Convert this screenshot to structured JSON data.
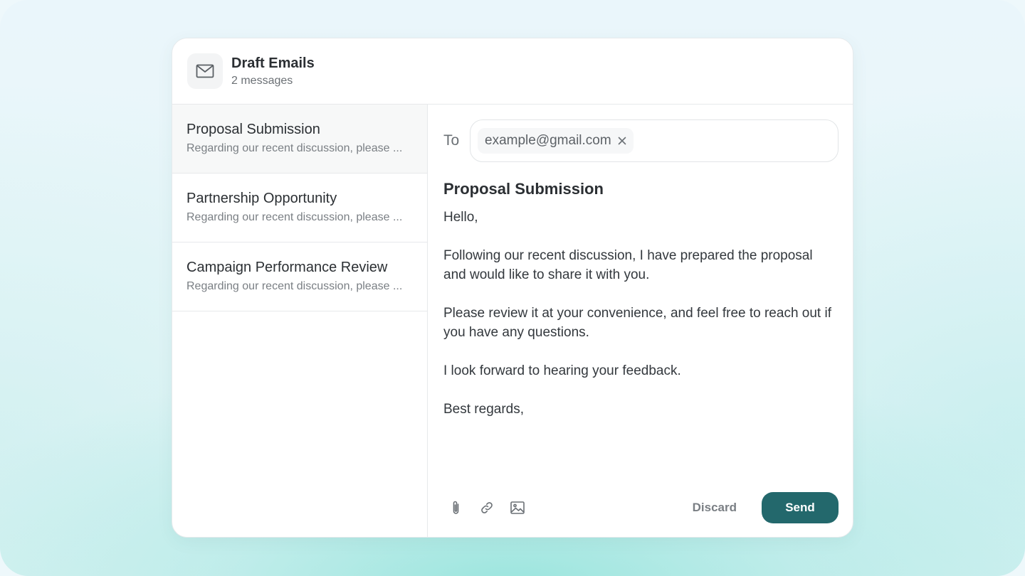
{
  "header": {
    "title": "Draft Emails",
    "subtitle": "2 messages",
    "icon": "mail-icon"
  },
  "drafts": [
    {
      "title": "Proposal Submission",
      "preview": "Regarding our recent discussion, please ...",
      "active": true
    },
    {
      "title": "Partnership Opportunity",
      "preview": "Regarding our recent discussion, please ...",
      "active": false
    },
    {
      "title": "Campaign Performance Review",
      "preview": "Regarding our recent discussion, please ...",
      "active": false
    }
  ],
  "compose": {
    "to_label": "To",
    "recipient": "example@gmail.com",
    "subject": "Proposal Submission",
    "body": [
      "Hello,",
      "Following our recent discussion, I have prepared the proposal and would like to share it with you.",
      "Please review it at your convenience, and feel free to reach out if you have any questions.",
      "I look forward to hearing your feedback.",
      "Best regards,"
    ]
  },
  "toolbar": {
    "icons": [
      "paperclip-icon",
      "link-icon",
      "image-icon"
    ],
    "discard_label": "Discard",
    "send_label": "Send"
  },
  "colors": {
    "accent": "#23686c",
    "active_row": "#f7f8f8",
    "border": "#e7e9eb"
  }
}
